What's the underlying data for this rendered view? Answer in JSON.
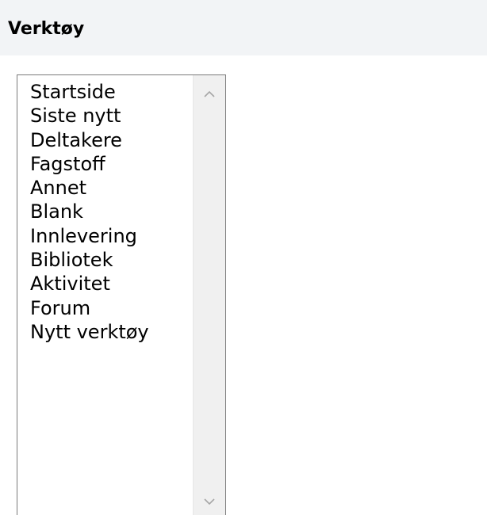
{
  "header": {
    "title": "Verktøy"
  },
  "listbox": {
    "items": [
      {
        "label": "Startside"
      },
      {
        "label": "Siste nytt"
      },
      {
        "label": "Deltakere"
      },
      {
        "label": "Fagstoff"
      },
      {
        "label": "Annet"
      },
      {
        "label": "Blank"
      },
      {
        "label": "Innlevering"
      },
      {
        "label": "Bibliotek"
      },
      {
        "label": "Aktivitet"
      },
      {
        "label": "Forum"
      },
      {
        "label": "Nytt verktøy"
      }
    ],
    "scroll_up_icon": "chevron-up-icon",
    "scroll_down_icon": "chevron-down-icon"
  },
  "colors": {
    "header_background": "#f2f4f6",
    "list_border": "#7a7a7a",
    "scrollbar_track": "#f0f0f0",
    "arrow": "#a6a6a6"
  }
}
